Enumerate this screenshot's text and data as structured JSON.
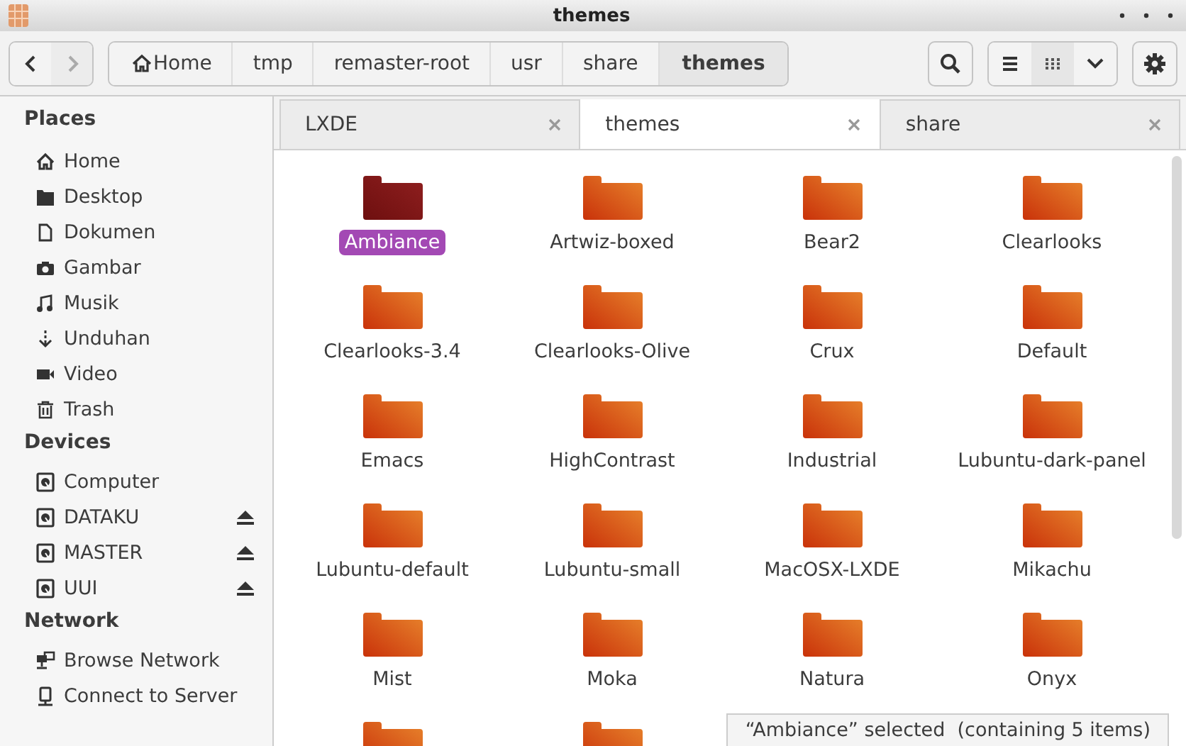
{
  "window": {
    "title": "themes"
  },
  "nav": {
    "back_disabled": false,
    "forward_disabled": true
  },
  "path": [
    {
      "label": "Home",
      "kind": "home",
      "selected": false
    },
    {
      "label": "tmp",
      "selected": false
    },
    {
      "label": "remaster-root",
      "selected": false
    },
    {
      "label": "usr",
      "selected": false
    },
    {
      "label": "share",
      "selected": false
    },
    {
      "label": "themes",
      "selected": true
    }
  ],
  "views": [
    {
      "kind": "list",
      "selected": false
    },
    {
      "kind": "grid",
      "selected": true
    }
  ],
  "sidebar": [
    {
      "heading": "Places",
      "items": [
        {
          "label": "Home",
          "kind": "home"
        },
        {
          "label": "Desktop",
          "kind": "desktop"
        },
        {
          "label": "Dokumen",
          "kind": "document"
        },
        {
          "label": "Gambar",
          "kind": "camera"
        },
        {
          "label": "Musik",
          "kind": "music"
        },
        {
          "label": "Unduhan",
          "kind": "download"
        },
        {
          "label": "Video",
          "kind": "video"
        },
        {
          "label": "Trash",
          "kind": "trash"
        }
      ]
    },
    {
      "heading": "Devices",
      "items": [
        {
          "label": "Computer",
          "kind": "drive",
          "ejectable": false
        },
        {
          "label": "DATAKU",
          "kind": "drive",
          "ejectable": true
        },
        {
          "label": "MASTER",
          "kind": "drive",
          "ejectable": true
        },
        {
          "label": "UUI",
          "kind": "drive",
          "ejectable": true
        }
      ]
    },
    {
      "heading": "Network",
      "items": [
        {
          "label": "Browse Network",
          "kind": "network"
        },
        {
          "label": "Connect to Server",
          "kind": "server"
        }
      ]
    }
  ],
  "tabs": [
    {
      "label": "LXDE",
      "selected": false
    },
    {
      "label": "themes",
      "selected": true
    },
    {
      "label": "share",
      "selected": false
    }
  ],
  "folders": [
    {
      "label": "Ambiance",
      "selected": true
    },
    {
      "label": "Artwiz-boxed",
      "selected": false
    },
    {
      "label": "Bear2",
      "selected": false
    },
    {
      "label": "Clearlooks",
      "selected": false
    },
    {
      "label": "Clearlooks-3.4",
      "selected": false
    },
    {
      "label": "Clearlooks-Olive",
      "selected": false
    },
    {
      "label": "Crux",
      "selected": false
    },
    {
      "label": "Default",
      "selected": false
    },
    {
      "label": "Emacs",
      "selected": false
    },
    {
      "label": "HighContrast",
      "selected": false
    },
    {
      "label": "Industrial",
      "selected": false
    },
    {
      "label": "Lubuntu-dark-panel",
      "selected": false
    },
    {
      "label": "Lubuntu-default",
      "selected": false
    },
    {
      "label": "Lubuntu-small",
      "selected": false
    },
    {
      "label": "MacOSX-LXDE",
      "selected": false
    },
    {
      "label": "Mikachu",
      "selected": false
    },
    {
      "label": "Mist",
      "selected": false
    },
    {
      "label": "Moka",
      "selected": false
    },
    {
      "label": "Natura",
      "selected": false
    },
    {
      "label": "Onyx",
      "selected": false
    },
    {
      "selected": false
    },
    {
      "selected": false
    }
  ],
  "status_bar": "“Ambiance” selected  (containing 5 items)"
}
